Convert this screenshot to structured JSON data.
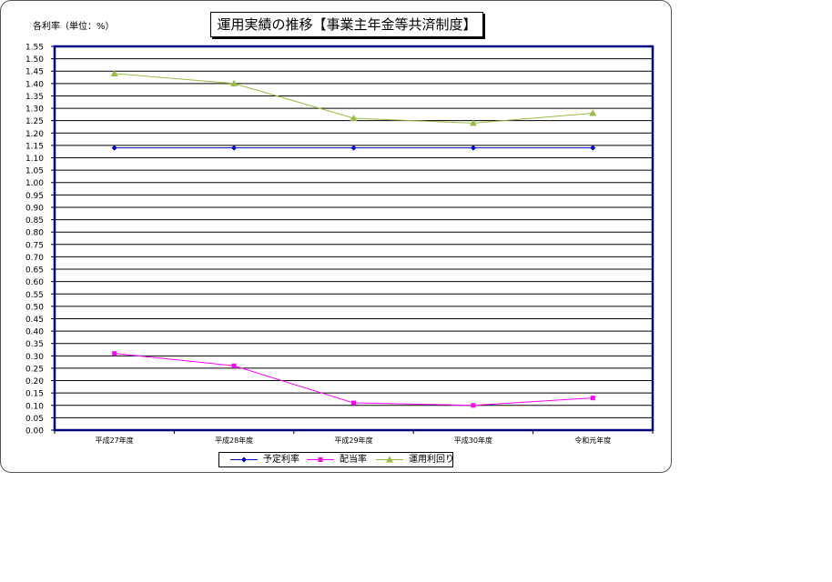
{
  "chart": {
    "title": "運用実績の推移【事業主年金等共済制度】",
    "y_unit_label": "各利率（単位：%）"
  },
  "chart_data": {
    "type": "line",
    "title": "運用実績の推移【事業主年金等共済制度】",
    "ylabel": "各利率（単位：%）",
    "xlabel": "",
    "categories": [
      "平成27年度",
      "平成28年度",
      "平成29年度",
      "平成30年度",
      "令和元年度"
    ],
    "ylim": [
      0,
      1.55
    ],
    "ytick_step": 0.05,
    "grid": true,
    "legend_position": "bottom",
    "series": [
      {
        "name": "予定利率",
        "values": [
          1.14,
          1.14,
          1.14,
          1.14,
          1.14
        ],
        "color": "#0000cc",
        "marker": "diamond"
      },
      {
        "name": "配当率",
        "values": [
          0.31,
          0.26,
          0.11,
          0.1,
          0.13
        ],
        "color": "#ff00ff",
        "marker": "square"
      },
      {
        "name": "運用利回り",
        "values": [
          1.44,
          1.4,
          1.26,
          1.24,
          1.28
        ],
        "color": "#99bb44",
        "marker": "triangle"
      }
    ]
  },
  "colors": {
    "plot_border": "#000080",
    "gridline": "#000000"
  }
}
